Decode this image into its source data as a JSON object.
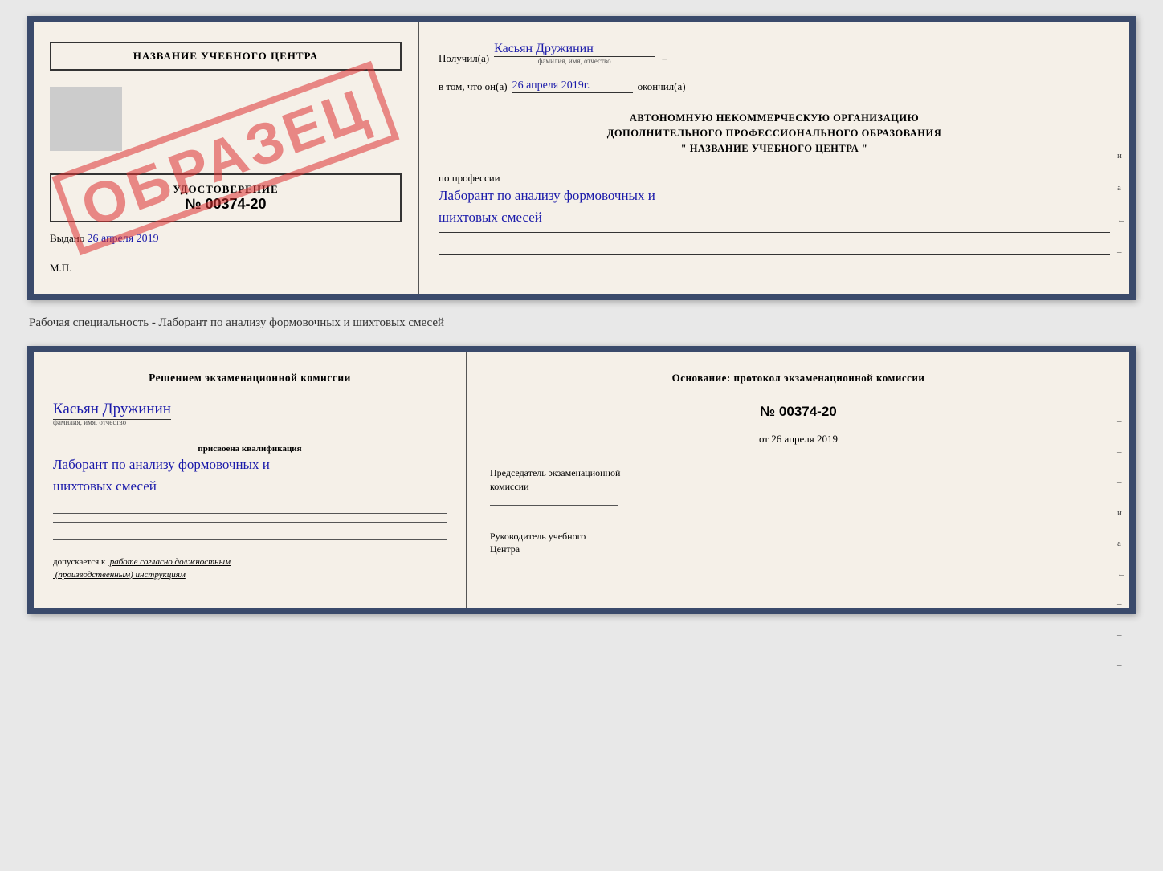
{
  "top_card": {
    "left": {
      "title": "НАЗВАНИЕ УЧЕБНОГО ЦЕНТРА",
      "cert_label": "УДОСТОВЕРЕНИЕ",
      "cert_number": "№ 00374-20",
      "issued_prefix": "Выдано",
      "issued_date": "26 апреля 2019",
      "mp": "М.П.",
      "stamp_text": "ОБРАЗЕЦ"
    },
    "right": {
      "received_prefix": "Получил(а)",
      "received_name": "Касьян Дружинин",
      "name_sublabel": "фамилия, имя, отчество",
      "fact_prefix": "в том, что он(а)",
      "fact_date": "26 апреля 2019г.",
      "fact_suffix": "окончил(а)",
      "org_line1": "АВТОНОМНУЮ НЕКОММЕРЧЕСКУЮ ОРГАНИЗАЦИЮ",
      "org_line2": "ДОПОЛНИТЕЛЬНОГО ПРОФЕССИОНАЛЬНОГО ОБРАЗОВАНИЯ",
      "org_quote": "\" НАЗВАНИЕ УЧЕБНОГО ЦЕНТРА \"",
      "profession_prefix": "по профессии",
      "profession_hw": "Лаборант по анализу формовочных и\nшихтовых смесей",
      "right_chars": [
        "и",
        "а",
        "←",
        "–",
        "–",
        "–"
      ]
    }
  },
  "specialty_line": "Рабочая специальность - Лаборант по анализу формовочных и шихтовых смесей",
  "bottom_card": {
    "left": {
      "commission_text": "Решением экзаменационной комиссии",
      "name_hw": "Касьян Дружинин",
      "name_sublabel": "фамилия, имя, отчество",
      "qualification_label": "присвоена квалификация",
      "qualification_hw": "Лаборант по анализу формовочных и\nшихтовых смесей",
      "допуск_prefix": "допускается к",
      "допуск_text": "работе согласно должностным\n(производственным) инструкциям"
    },
    "right": {
      "osnov_text": "Основание: протокол экзаменационной комиссии",
      "protocol_number": "№ 00374-20",
      "date_prefix": "от",
      "date_value": "26 апреля 2019",
      "chairman_title": "Председатель экзаменационной\nкомиссии",
      "director_title": "Руководитель учебного\nЦентра",
      "right_chars": [
        "–",
        "–",
        "–",
        "и",
        "а",
        "←",
        "–",
        "–",
        "–"
      ]
    }
  }
}
